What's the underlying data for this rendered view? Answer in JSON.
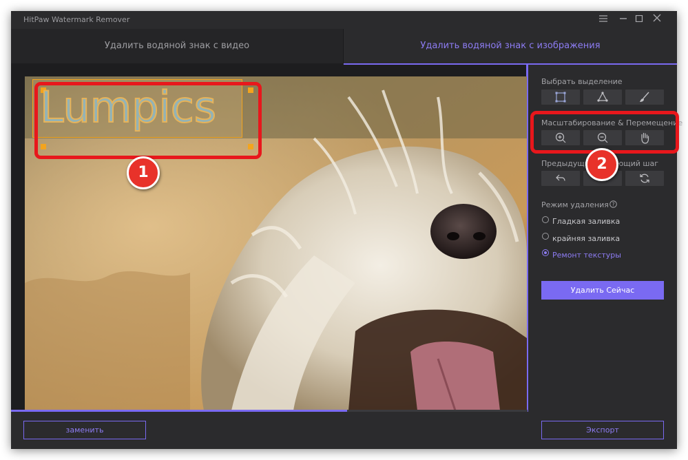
{
  "window": {
    "title": "HitPaw Watermark Remover",
    "controls": [
      "menu-icon",
      "minimize-icon",
      "maximize-icon",
      "close-icon"
    ]
  },
  "tabs": [
    {
      "label": "Удалить водяной знак с видео",
      "active": false
    },
    {
      "label": "Удалить водяной знак с изображения",
      "active": true
    }
  ],
  "canvas": {
    "watermark_text": "Lumpics",
    "progress": 0.65
  },
  "panel": {
    "selection": {
      "title": "Выбрать выделение",
      "tools": [
        "rectangle-select-icon",
        "polygon-lasso-icon",
        "brush-icon"
      ]
    },
    "zoom": {
      "title": "Масштабирование & Перемещение",
      "tools": [
        "zoom-in-icon",
        "zoom-out-icon",
        "hand-pan-icon"
      ]
    },
    "history": {
      "title_left": "Предыдущи",
      "title_right": "ющий шаг",
      "tools": [
        "undo-icon",
        "redo-icon",
        "reset-icon"
      ]
    },
    "mode": {
      "title": "Режим удаления",
      "help_icon": "help-circle-icon",
      "options": [
        {
          "label": "Гладкая заливка",
          "selected": false
        },
        {
          "label": "крайняя заливка",
          "selected": false
        },
        {
          "label": "Ремонт текстуры",
          "selected": true
        }
      ]
    },
    "remove_button": "Удалить Сейчас"
  },
  "footer": {
    "replace_button": "заменить",
    "export_button": "Экспорт"
  },
  "annotations": {
    "marker_1": "1",
    "marker_2": "2"
  },
  "colors": {
    "accent": "#7a6af2",
    "annotation_red": "#e8171c",
    "background": "#2b2b2d"
  }
}
